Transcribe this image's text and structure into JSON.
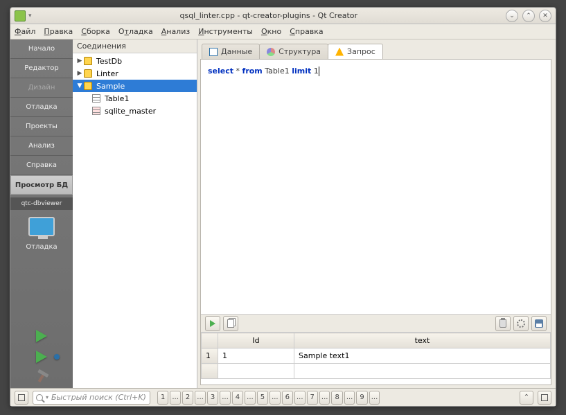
{
  "titlebar": {
    "title": "qsql_linter.cpp - qt-creator-plugins - Qt Creator"
  },
  "menu": {
    "file": "Файл",
    "edit": "Правка",
    "build": "Сборка",
    "debug": "Отладка",
    "analyze": "Анализ",
    "tools": "Инструменты",
    "window": "Окно",
    "help": "Справка"
  },
  "leftbar": {
    "items": [
      "Начало",
      "Редактор",
      "Дизайн",
      "Отладка",
      "Проекты",
      "Анализ",
      "Справка"
    ],
    "selected": "Просмотр БД",
    "project": "qtc-dbviewer",
    "run_label": "Отладка"
  },
  "tree": {
    "header": "Соединения",
    "nodes": [
      {
        "label": "TestDb",
        "kind": "db",
        "expanded": false
      },
      {
        "label": "Linter",
        "kind": "db",
        "expanded": false
      },
      {
        "label": "Sample",
        "kind": "db",
        "expanded": true,
        "selected": true,
        "children": [
          {
            "label": "Table1",
            "kind": "table"
          },
          {
            "label": "sqlite_master",
            "kind": "table-master"
          }
        ]
      }
    ]
  },
  "tabs": {
    "data": "Данные",
    "structure": "Структура",
    "query": "Запрос"
  },
  "editor": {
    "k1": "select",
    "t1": " * ",
    "k2": "from",
    "t2": " Table1 ",
    "k3": "limit",
    "t3": " 1"
  },
  "results": {
    "cols": [
      "Id",
      "text"
    ],
    "rows": [
      {
        "n": "1",
        "Id": "1",
        "text": "Sample text1"
      }
    ]
  },
  "statusbar": {
    "search_placeholder": "Быстрый поиск (Ctrl+K)",
    "nums": [
      "1",
      "2",
      "3",
      "4",
      "5",
      "6",
      "7",
      "8",
      "9"
    ]
  }
}
